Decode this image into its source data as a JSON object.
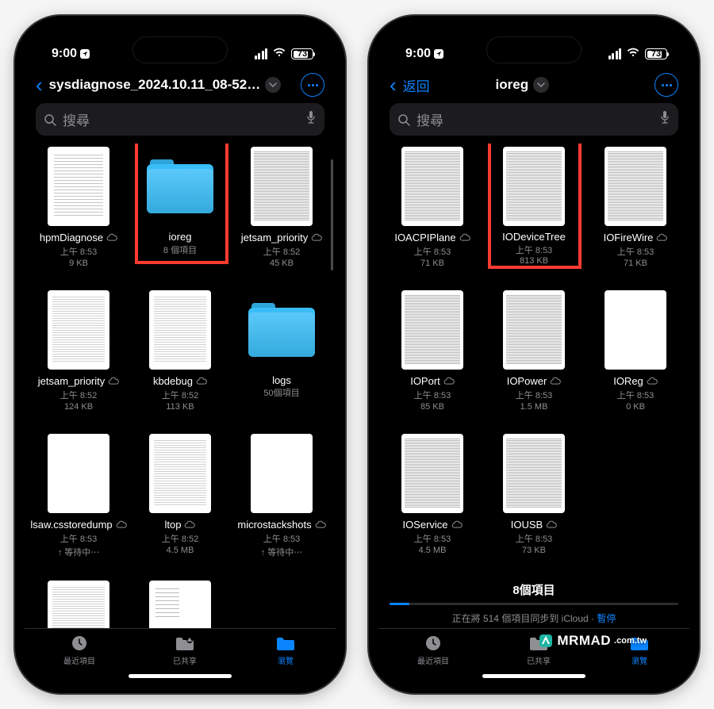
{
  "status": {
    "time": "9:00",
    "battery": "73"
  },
  "phoneA": {
    "title": "sysdiagnose_2024.10.11_08-52…",
    "search_placeholder": "搜尋",
    "items": [
      {
        "name": "hpmDiagnose",
        "time": "上午 8:53",
        "size": "9 KB",
        "cloud": true,
        "type": "doc"
      },
      {
        "name": "ioreg",
        "time": "8 個項目",
        "size": "",
        "cloud": false,
        "type": "folder"
      },
      {
        "name": "jetsam_priority",
        "time": "上午 8:52",
        "size": "45 KB",
        "cloud": true,
        "type": "dense"
      },
      {
        "name": "jetsam_priority",
        "time": "上午 8:52",
        "size": "124 KB",
        "cloud": true,
        "type": "doc2"
      },
      {
        "name": "kbdebug",
        "time": "上午 8:52",
        "size": "113 KB",
        "cloud": true,
        "type": "doc2"
      },
      {
        "name": "logs",
        "time": "50個項目",
        "size": "",
        "cloud": false,
        "type": "folder"
      },
      {
        "name": "lsaw.csstoredump",
        "time": "上午 8:53",
        "size": "↑ 等待中⋯",
        "cloud": true,
        "type": "blank"
      },
      {
        "name": "ltop",
        "time": "上午 8:52",
        "size": "4.5 MB",
        "cloud": true,
        "type": "doc2"
      },
      {
        "name": "microstackshots",
        "time": "上午 8:53",
        "size": "↑ 等待中⋯",
        "cloud": true,
        "type": "blank"
      },
      {
        "name": "",
        "time": "",
        "size": "",
        "cloud": false,
        "type": "doc2"
      },
      {
        "name": "",
        "time": "",
        "size": "",
        "cloud": false,
        "type": "sparse"
      }
    ]
  },
  "phoneB": {
    "back_label": "返回",
    "title": "ioreg",
    "search_placeholder": "搜尋",
    "items": [
      {
        "name": "IOACPIPlane",
        "time": "上午 8:53",
        "size": "71 KB",
        "cloud": true,
        "type": "dense"
      },
      {
        "name": "IODeviceTree",
        "time": "上午 8:53",
        "size": "813 KB",
        "cloud": false,
        "type": "dense"
      },
      {
        "name": "IOFireWire",
        "time": "上午 8:53",
        "size": "71 KB",
        "cloud": true,
        "type": "dense"
      },
      {
        "name": "IOPort",
        "time": "上午 8:53",
        "size": "85 KB",
        "cloud": true,
        "type": "dense"
      },
      {
        "name": "IOPower",
        "time": "上午 8:53",
        "size": "1.5 MB",
        "cloud": true,
        "type": "dense"
      },
      {
        "name": "IOReg",
        "time": "上午 8:53",
        "size": "0 KB",
        "cloud": true,
        "type": "blank"
      },
      {
        "name": "IOService",
        "time": "上午 8:53",
        "size": "4.5 MB",
        "cloud": true,
        "type": "dense"
      },
      {
        "name": "IOUSB",
        "time": "上午 8:53",
        "size": "73 KB",
        "cloud": true,
        "type": "dense"
      }
    ],
    "summary": "8個項目",
    "sync_text": "正在將 514 個項目同步到 iCloud",
    "pause_label": "暫停"
  },
  "tabs": {
    "recent": "最近項目",
    "shared": "已共享",
    "browse": "瀏覽"
  },
  "watermark": {
    "brand": "MRMAD",
    "suffix": ".com.tw"
  }
}
